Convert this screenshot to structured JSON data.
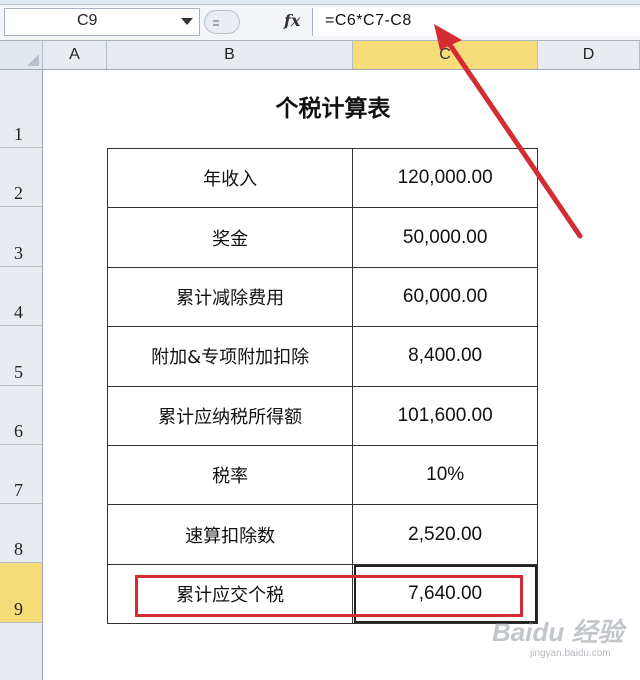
{
  "formula_bar": {
    "name_box": "C9",
    "fx_label": "fx",
    "formula": "=C6*C7-C8"
  },
  "columns": [
    "A",
    "B",
    "C",
    "D"
  ],
  "rows": [
    "1",
    "2",
    "3",
    "4",
    "5",
    "6",
    "7",
    "8",
    "9"
  ],
  "selected": {
    "column": "C",
    "row": "9"
  },
  "sheet": {
    "title": "个税计算表",
    "items": [
      {
        "label": "年收入",
        "value": "120,000.00"
      },
      {
        "label": "奖金",
        "value": "50,000.00"
      },
      {
        "label": "累计减除费用",
        "value": "60,000.00"
      },
      {
        "label": "附加&专项附加扣除",
        "value": "8,400.00"
      },
      {
        "label": "累计应纳税所得额",
        "value": "101,600.00"
      },
      {
        "label": "税率",
        "value": "10%"
      },
      {
        "label": "速算扣除数",
        "value": "2,520.00"
      },
      {
        "label": "累计应交个税",
        "value": "7,640.00"
      }
    ]
  },
  "annotation": {
    "color": "#d52b32",
    "arrow_icon": "red-pointer-arrow"
  },
  "watermark": {
    "text": "Baidu 经验",
    "subtext": "jingyan.baidu.com"
  }
}
